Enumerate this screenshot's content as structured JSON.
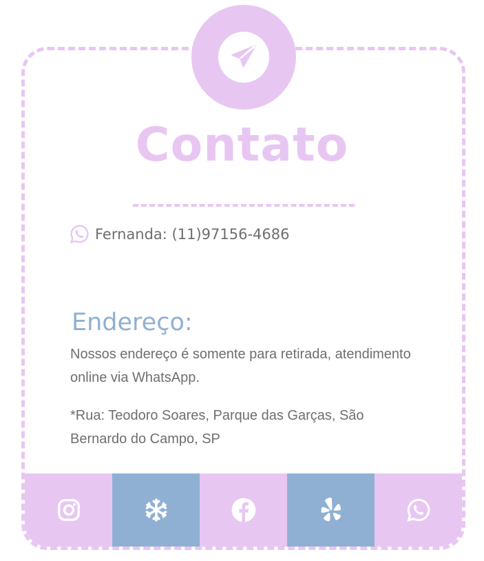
{
  "header": {
    "title": "Contato",
    "badge_icon": "paper-plane-icon"
  },
  "contact": {
    "phone_icon": "whatsapp-icon",
    "phone_text": "Fernanda: (11)97156-4686"
  },
  "address": {
    "title": "Endereço:",
    "line1": "Nossos endereço é somente para retirada, atendimento online via WhatsApp.",
    "line2": "*Rua: Teodoro Soares, Parque das Garças, São Bernardo do Campo, SP"
  },
  "social": [
    {
      "icon": "instagram-icon",
      "bg": "#e8c6f2"
    },
    {
      "icon": "snowflake-icon",
      "bg": "#8fb0d3"
    },
    {
      "icon": "facebook-icon",
      "bg": "#e8c6f2"
    },
    {
      "icon": "yelp-icon",
      "bg": "#8fb0d3"
    },
    {
      "icon": "whatsapp-icon",
      "bg": "#e8c6f2"
    }
  ],
  "colors": {
    "primary": "#e8c6f2",
    "secondary": "#8fb0d3",
    "text": "#6e6e6e"
  }
}
